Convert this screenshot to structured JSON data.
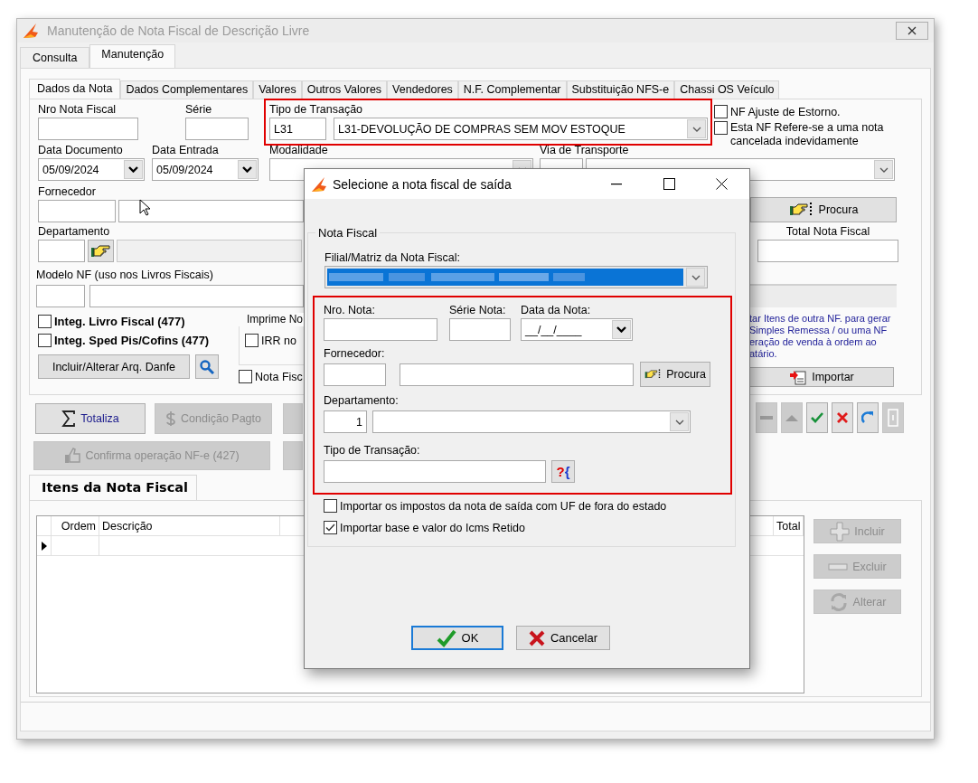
{
  "main_window": {
    "title": "Manutenção de Nota Fiscal de Descrição Livre"
  },
  "outer_tabs": [
    {
      "label": "Consulta",
      "selected": false
    },
    {
      "label": "Manutenção",
      "selected": true
    }
  ],
  "inner_tabs": [
    {
      "label": "Dados da Nota",
      "selected": true
    },
    {
      "label": "Dados Complementares",
      "selected": false
    },
    {
      "label": "Valores",
      "selected": false
    },
    {
      "label": "Outros Valores",
      "selected": false
    },
    {
      "label": "Vendedores",
      "selected": false
    },
    {
      "label": "N.F. Complementar",
      "selected": false
    },
    {
      "label": "Substituição NFS-e",
      "selected": false
    },
    {
      "label": "Chassi OS Veículo",
      "selected": false
    }
  ],
  "form": {
    "nro_nota_fiscal": {
      "label": "Nro Nota Fiscal"
    },
    "serie": {
      "label": "Série"
    },
    "tipo_transacao": {
      "label": "Tipo de Transação",
      "code": "L31",
      "value": "L31-DEVOLUÇÃO DE COMPRAS SEM MOV ESTOQUE",
      "highlighted": true
    },
    "options": [
      {
        "label": "NF Ajuste de Estorno.",
        "checked": false
      },
      {
        "label": "Esta NF Refere-se a uma nota cancelada indevidamente",
        "checked": false
      }
    ],
    "data_documento": {
      "label": "Data Documento",
      "value": "05/09/2024"
    },
    "data_entrada": {
      "label": "Data Entrada",
      "value": "05/09/2024"
    },
    "modalidade": {
      "label": "Modalidade"
    },
    "via_transporte": {
      "label": "Via de Transporte"
    },
    "fornecedor": {
      "label": "Fornecedor"
    },
    "procura_button": {
      "label": "Procura"
    },
    "departamento": {
      "label": "Departamento"
    },
    "total_nota_fiscal": {
      "label": "Total Nota Fiscal"
    },
    "modelo_nf": {
      "label": "Modelo NF (uso nos Livros Fiscais)"
    },
    "integ_checks": [
      {
        "label": "Integ. Livro Fiscal (477)",
        "checked": false
      },
      {
        "label": "Integ. Sped Pis/Cofins (477)",
        "checked": false
      }
    ],
    "imprime_group": {
      "title": "Imprime No",
      "check": {
        "label": "IRR no",
        "checked": false
      }
    },
    "nota_fisc_check": {
      "label": "Nota Fisc",
      "checked": false
    },
    "danfe_button": {
      "label": "Incluir/Alterar Arq. Danfe"
    },
    "import_hint": [
      "tar Itens de outra NF. para gerar",
      "Simples Remessa / ou uma NF",
      "eração de venda à ordem ao",
      "atário."
    ],
    "importar_button": {
      "label": "Importar"
    }
  },
  "action_row_1": [
    {
      "label": "Totaliza",
      "kind": "sum",
      "disabled": false
    },
    {
      "label": "Condição Pagto",
      "kind": "money",
      "disabled": true
    }
  ],
  "action_row_2": [
    {
      "label": "Confirma operação NF-e (427)",
      "kind": "thumb",
      "disabled": true
    }
  ],
  "toolbar": [
    {
      "kind": "minus",
      "disabled": true
    },
    {
      "kind": "up",
      "disabled": true
    },
    {
      "kind": "check",
      "disabled": false
    },
    {
      "kind": "cancel",
      "disabled": false
    },
    {
      "kind": "redo",
      "disabled": false
    },
    {
      "kind": "door",
      "disabled": true
    }
  ],
  "items_tab": {
    "label": "Itens da Nota Fiscal",
    "selected": true
  },
  "items_grid": {
    "columns": [
      "Ordem",
      "Descrição",
      "Total"
    ]
  },
  "item_buttons": [
    {
      "label": "Incluir",
      "kind": "add",
      "disabled": true
    },
    {
      "label": "Excluir",
      "kind": "remove",
      "disabled": true
    },
    {
      "label": "Alterar",
      "kind": "refresh",
      "disabled": true
    }
  ],
  "dialog": {
    "title": "Selecione a nota fiscal de saída",
    "group_title": "Nota Fiscal",
    "filial_label": "Filial/Matriz da Nota Fiscal:",
    "highlighted": true,
    "nro_nota_label": "Nro. Nota:",
    "serie_nota_label": "Série Nota:",
    "data_nota": {
      "label": "Data da Nota:",
      "value": "__/__/____"
    },
    "fornecedor_label": "Fornecedor:",
    "procura_button": "Procura",
    "departamento": {
      "label": "Departamento:",
      "code": "1"
    },
    "tipo_transacao_label": "Tipo de Transação:",
    "lookup_button": "?{",
    "options": [
      {
        "label": "Importar os impostos da nota de saída com UF de fora do estado",
        "checked": false
      },
      {
        "label": "Importar base e valor do Icms Retido",
        "checked": true
      }
    ],
    "buttons": [
      {
        "label": "OK",
        "kind": "ok",
        "focused": true
      },
      {
        "label": "Cancelar",
        "kind": "cancel",
        "focused": false
      }
    ]
  }
}
